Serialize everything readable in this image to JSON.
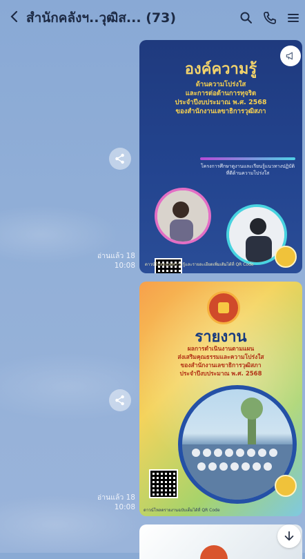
{
  "header": {
    "back_icon": "chevron-left-icon",
    "title": "สำนักคลังฯ..วุฒิส...",
    "member_count": "(73)",
    "icons": [
      "search-icon",
      "phone-icon",
      "menu-icon"
    ]
  },
  "messages": [
    {
      "read_status": "อ่านแล้ว 18",
      "time": "10:08",
      "card": {
        "heading": "องค์ความรู้",
        "subtitle_lines": [
          "ด้านความโปร่งใส",
          "และการต่อต้านการทุจริต",
          "ประจำปีงบประมาณ พ.ศ. 2568",
          "ของสำนักงานเลขาธิการวุฒิสภา"
        ],
        "note": "โครงการศึกษาดูงานและเรียนรู้แนวทางปฏิบัติที่ดีด้านความโปร่งใส",
        "footer": "ดาวน์โหลดองค์ความรู้และรายละเอียดเพิ่มเติมได้ที่ QR Code"
      }
    },
    {
      "read_status": "อ่านแล้ว 18",
      "time": "10:08",
      "card": {
        "heading": "รายงาน",
        "subtitle_lines": [
          "ผลการดำเนินงานตามแผน",
          "ส่งเสริมคุณธรรมและความโปร่งใส",
          "ของสำนักงานเลขาธิการวุฒิสภา",
          "ประจำปีงบประมาณ พ.ศ. 2568"
        ],
        "footer": "ดาวน์โหลดรายงานฉบับเต็มได้ที่ QR Code"
      }
    }
  ],
  "colors": {
    "background": "#8aaad4",
    "card1_bg": "#23448f",
    "card1_heading": "#f2d36b",
    "card2_heading": "#173a7f"
  }
}
